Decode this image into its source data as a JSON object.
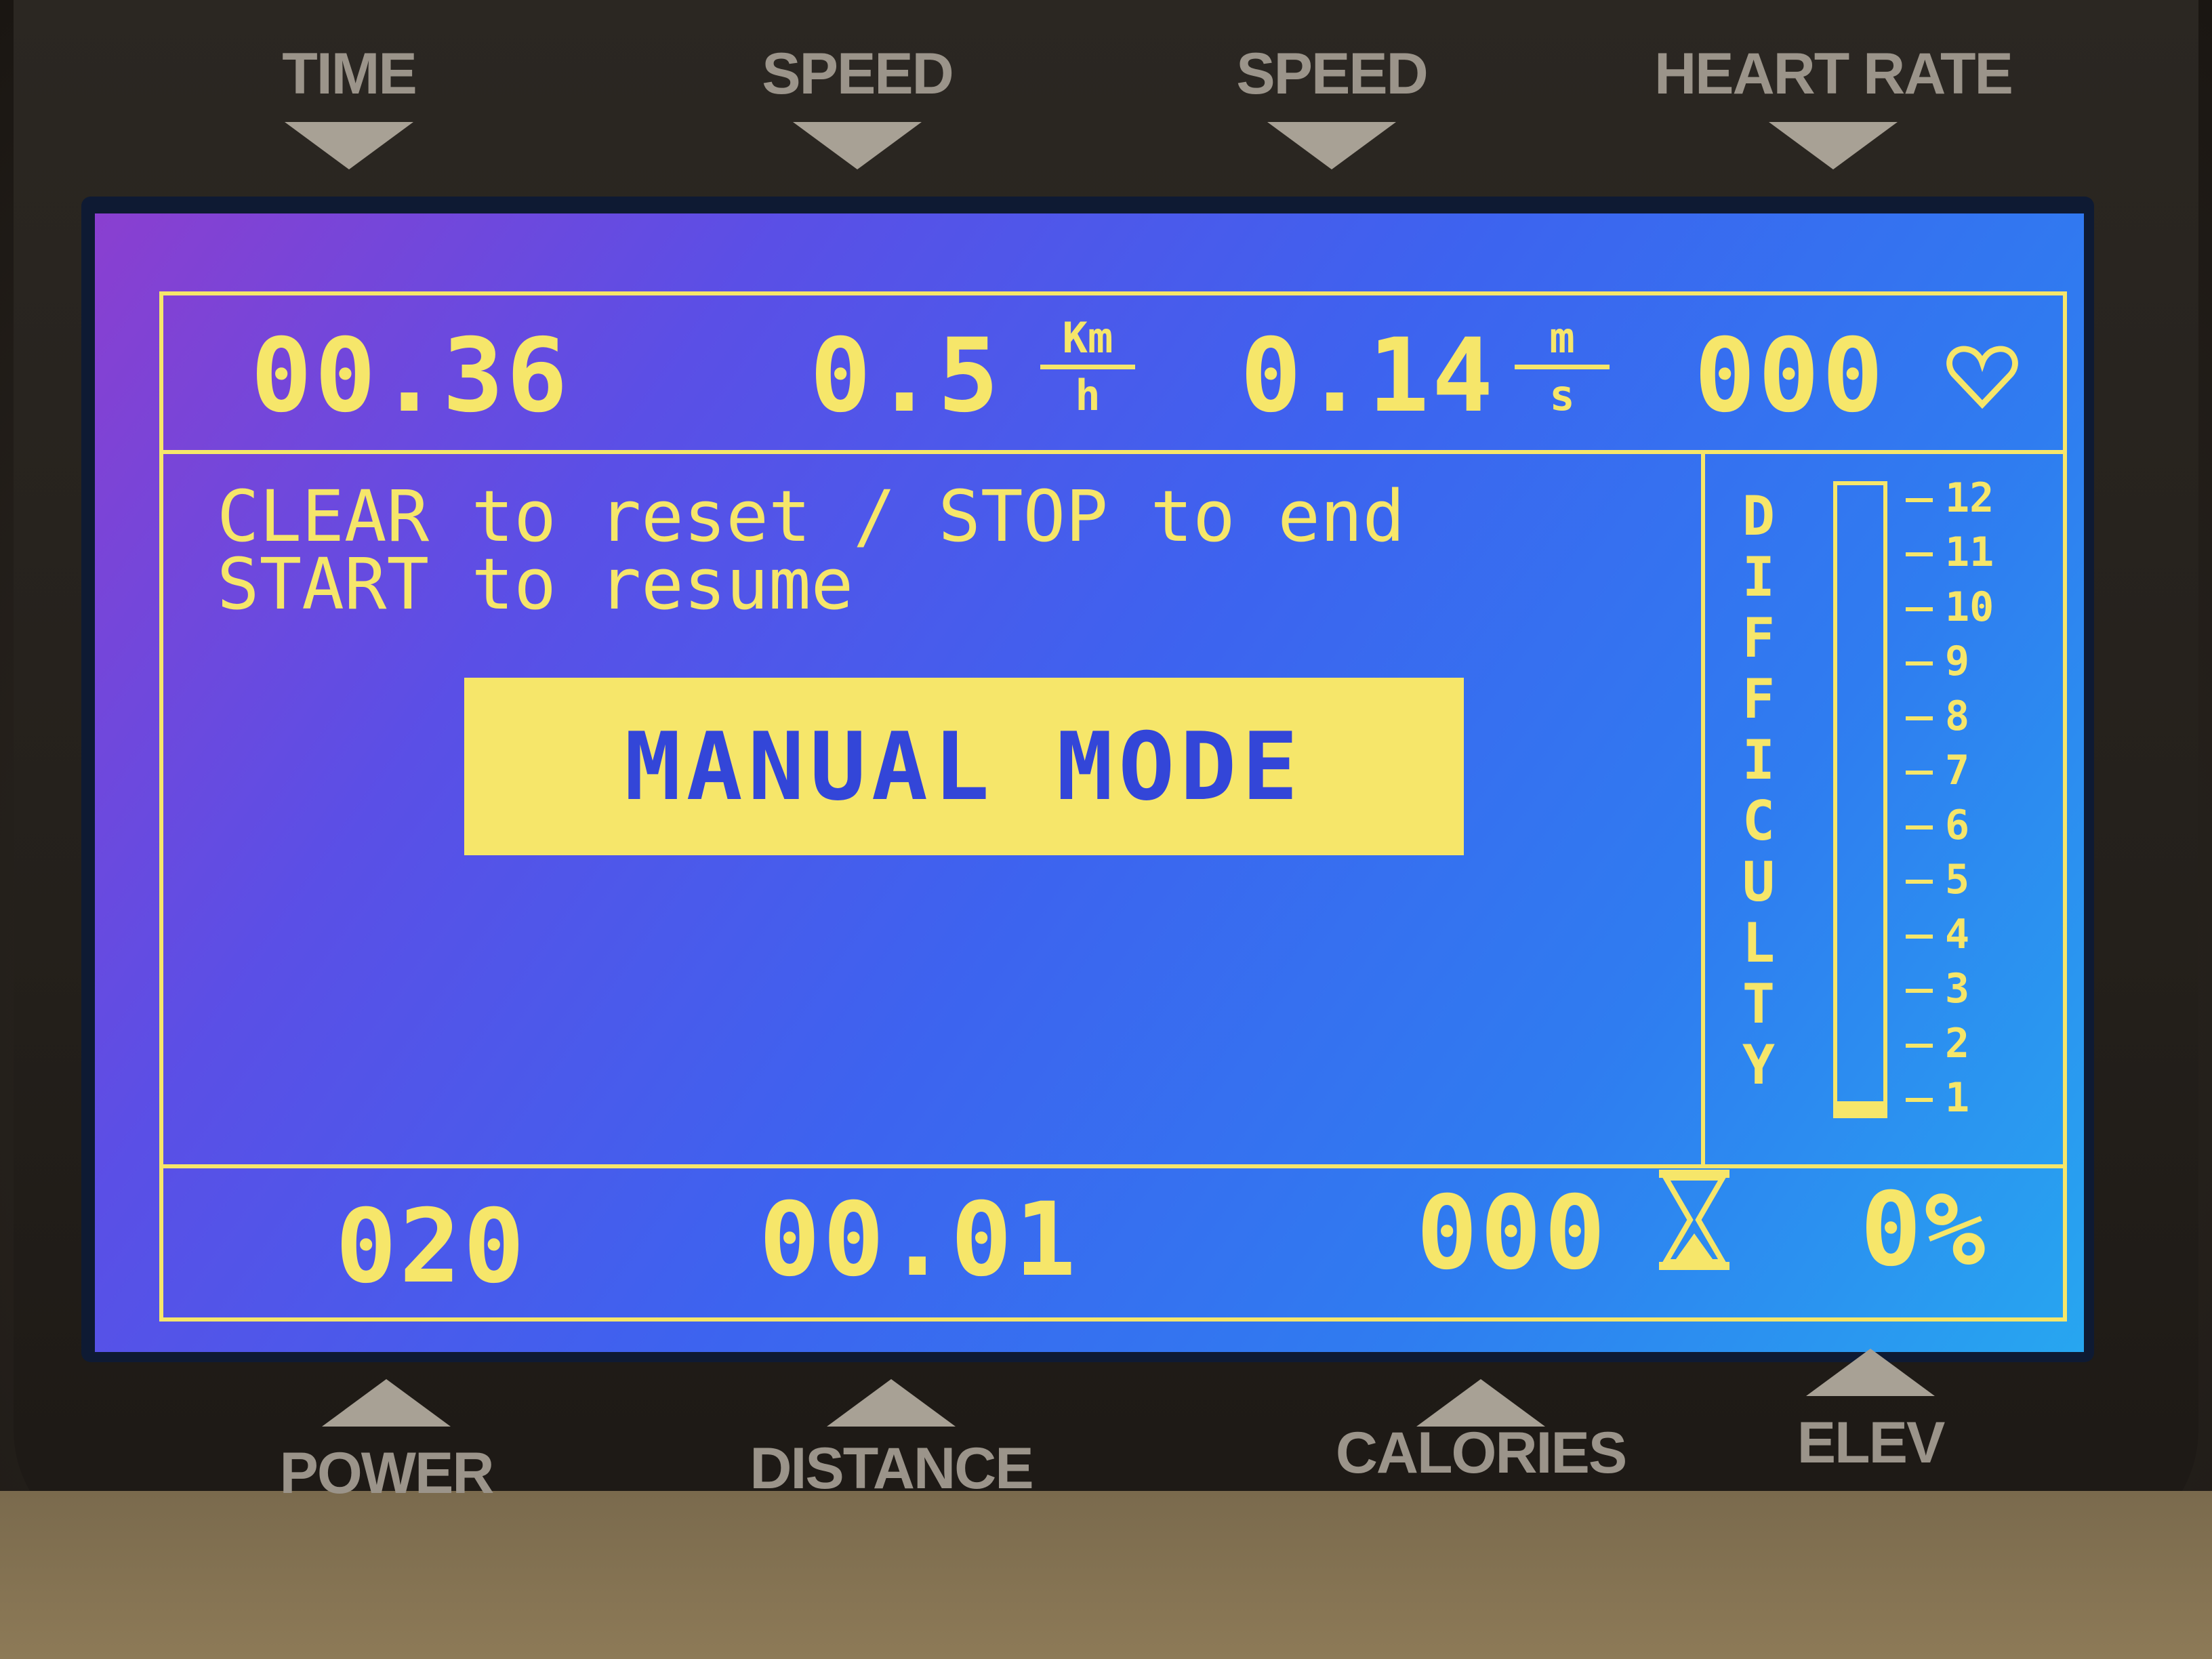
{
  "console": {
    "top_labels": [
      "TIME",
      "SPEED",
      "SPEED",
      "HEART RATE"
    ],
    "bottom_labels": [
      "POWER",
      "DISTANCE",
      "CALORIES",
      "ELEV"
    ]
  },
  "display": {
    "time": "00.36",
    "speed_kmh": "0.5",
    "speed_kmh_unit_num": "Km",
    "speed_kmh_unit_den": "h",
    "speed_ms": "0.14",
    "speed_ms_unit_num": "m",
    "speed_ms_unit_den": "s",
    "heart_rate": "000",
    "message_line1": "CLEAR to reset / STOP to end",
    "message_line2": "START to resume",
    "mode": "MANUAL MODE",
    "difficulty_label": [
      "D",
      "I",
      "F",
      "F",
      "I",
      "C",
      "U",
      "L",
      "T",
      "Y"
    ],
    "difficulty_scale": [
      "12",
      "11",
      "10",
      "9",
      "8",
      "7",
      "6",
      "5",
      "4",
      "3",
      "2",
      "1"
    ],
    "difficulty_level_fraction": 0.02,
    "power": "020",
    "distance": "00.01",
    "calories": "000",
    "elevation": "0%"
  },
  "colors": {
    "lcd_text": "#f6e66a",
    "mode_text": "#3346d8"
  },
  "icons": {
    "heart": "heart-outline-icon",
    "hourglass": "hourglass-icon"
  }
}
